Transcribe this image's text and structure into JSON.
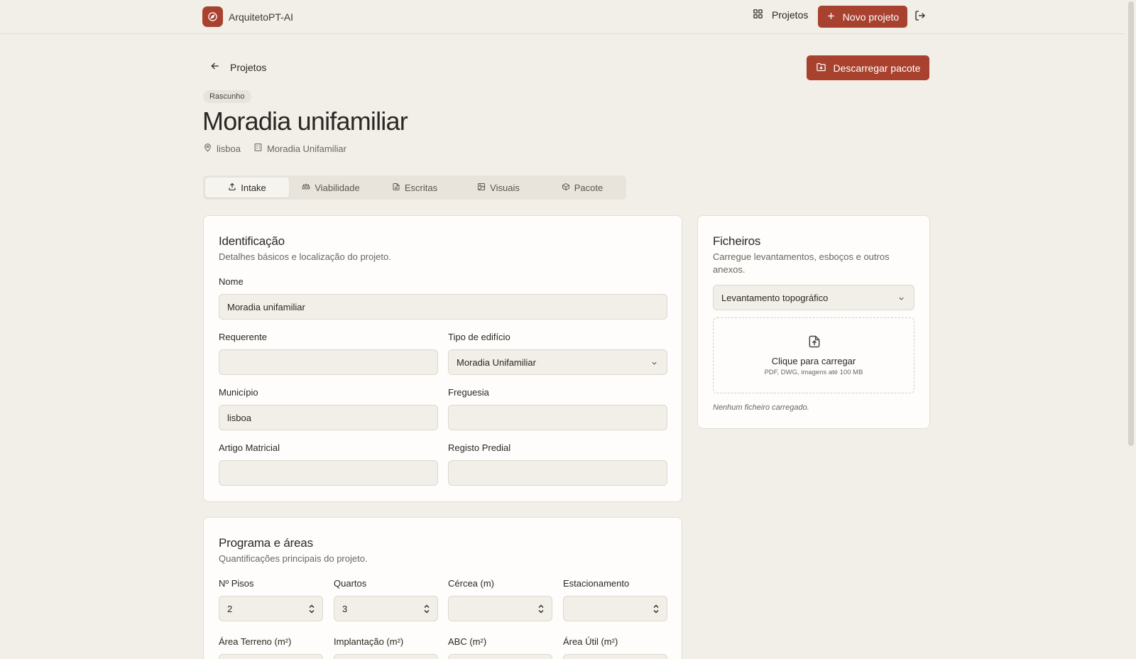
{
  "app": {
    "name": "ArquitetoPT-AI"
  },
  "topbar": {
    "projects_label": "Projetos",
    "new_project_label": "Novo projeto"
  },
  "header": {
    "back_label": "Projetos",
    "download_label": "Descarregar pacote",
    "status_badge": "Rascunho",
    "title": "Moradia unifamiliar",
    "location": "lisboa",
    "building_type": "Moradia Unifamiliar"
  },
  "tabs": [
    {
      "label": "Intake",
      "icon": "upload-icon",
      "active": true
    },
    {
      "label": "Viabilidade",
      "icon": "scale-icon",
      "active": false
    },
    {
      "label": "Escritas",
      "icon": "document-icon",
      "active": false
    },
    {
      "label": "Visuais",
      "icon": "image-icon",
      "active": false
    },
    {
      "label": "Pacote",
      "icon": "package-icon",
      "active": false
    }
  ],
  "identificacao": {
    "title": "Identificação",
    "description": "Detalhes básicos e localização do projeto.",
    "nome_label": "Nome",
    "nome_value": "Moradia unifamiliar",
    "requerente_label": "Requerente",
    "requerente_value": "",
    "tipo_label": "Tipo de edifício",
    "tipo_value": "Moradia Unifamiliar",
    "municipio_label": "Município",
    "municipio_value": "lisboa",
    "freguesia_label": "Freguesia",
    "freguesia_value": "",
    "artigo_label": "Artigo Matricial",
    "artigo_value": "",
    "registo_label": "Registo Predial",
    "registo_value": ""
  },
  "ficheiros": {
    "title": "Ficheiros",
    "description": "Carregue levantamentos, esboços e outros anexos.",
    "type_value": "Levantamento topográfico",
    "upload_title": "Clique para carregar",
    "upload_hint": "PDF, DWG, imagens até 100 MB",
    "empty_text": "Nenhum ficheiro carregado."
  },
  "programa": {
    "title": "Programa e áreas",
    "description": "Quantificações principais do projeto.",
    "pisos_label": "Nº Pisos",
    "pisos_value": "2",
    "quartos_label": "Quartos",
    "quartos_value": "3",
    "cercea_label": "Cércea (m)",
    "cercea_value": "",
    "estacionamento_label": "Estacionamento",
    "estacionamento_value": "",
    "area_terreno_label": "Área Terreno (m²)",
    "implantacao_label": "Implantação (m²)",
    "abc_label": "ABC (m²)",
    "area_util_label": "Área Útil (m²)"
  },
  "colors": {
    "accent": "#a8412e",
    "background": "#f2efe8",
    "card": "#fefdfb"
  }
}
